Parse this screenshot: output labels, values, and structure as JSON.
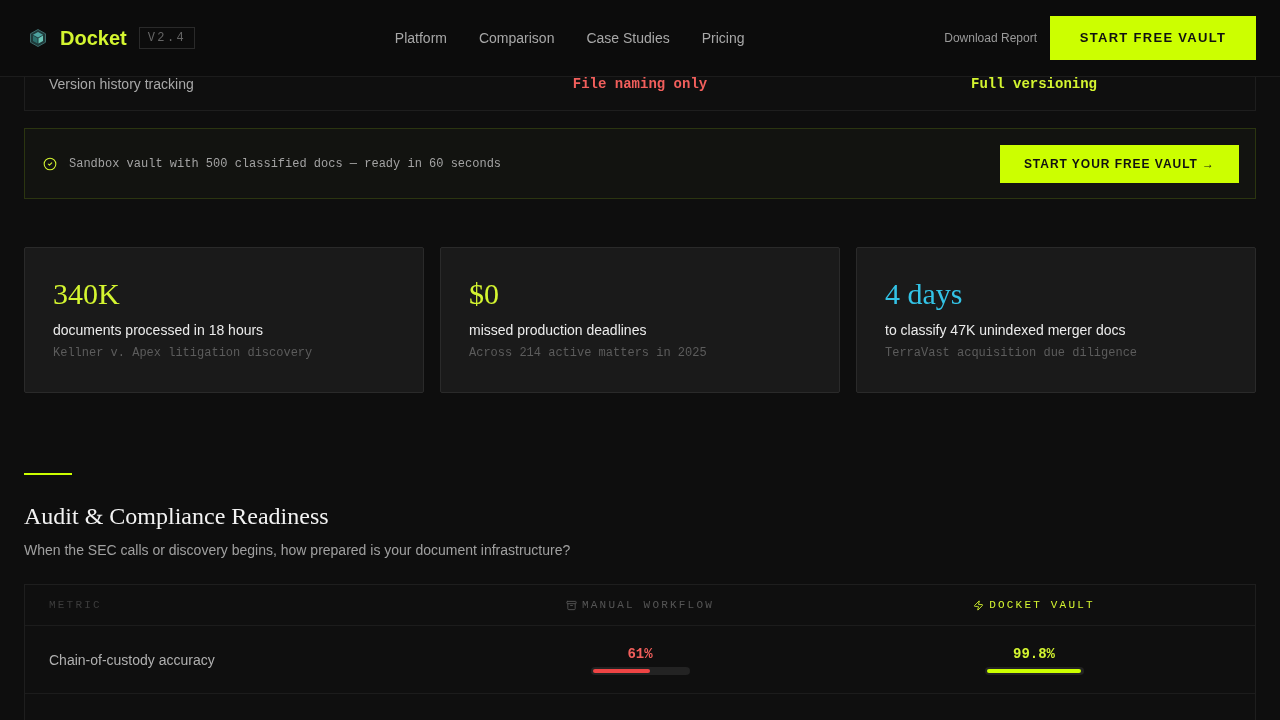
{
  "header": {
    "logo": "Docket",
    "version": "V2.4",
    "nav": [
      {
        "label": "Platform"
      },
      {
        "label": "Comparison"
      },
      {
        "label": "Case Studies"
      },
      {
        "label": "Pricing"
      }
    ],
    "download_link": "Download Report",
    "cta": "START FREE VAULT"
  },
  "previous_table": {
    "rows": [
      {
        "metric": "Version history tracking",
        "manual": {
          "kind": "text",
          "value": "File naming only"
        },
        "vault": {
          "kind": "text",
          "value": "Full versioning"
        }
      }
    ]
  },
  "banner": {
    "text": "Sandbox vault with 500 classified docs — ready in 60 seconds",
    "button": "START YOUR FREE VAULT →"
  },
  "stats": [
    {
      "value": "340K",
      "color": "#d4f530",
      "label": "documents processed in 18 hours",
      "source": "Kellner v. Apex litigation discovery"
    },
    {
      "value": "$0",
      "color": "#d4f530",
      "label": "missed production deadlines",
      "source": "Across 214 active matters in 2025"
    },
    {
      "value": "4 days",
      "color": "#33c3e6",
      "label": "to classify 47K unindexed merger docs",
      "source": "TerraVast acquisition due diligence"
    }
  ],
  "section": {
    "title": "Audit & Compliance Readiness",
    "subtitle": "When the SEC calls or discovery begins, how prepared is your document infrastructure?"
  },
  "table": {
    "columns": [
      "METRIC",
      "MANUAL WORKFLOW",
      "DOCKET VAULT"
    ],
    "rows": [
      {
        "metric": "Chain-of-custody accuracy",
        "manual": {
          "kind": "meter",
          "value": "61%",
          "level": 0.61
        },
        "vault": {
          "kind": "meter",
          "value": "99.8%",
          "level": 0.998
        }
      }
    ]
  }
}
